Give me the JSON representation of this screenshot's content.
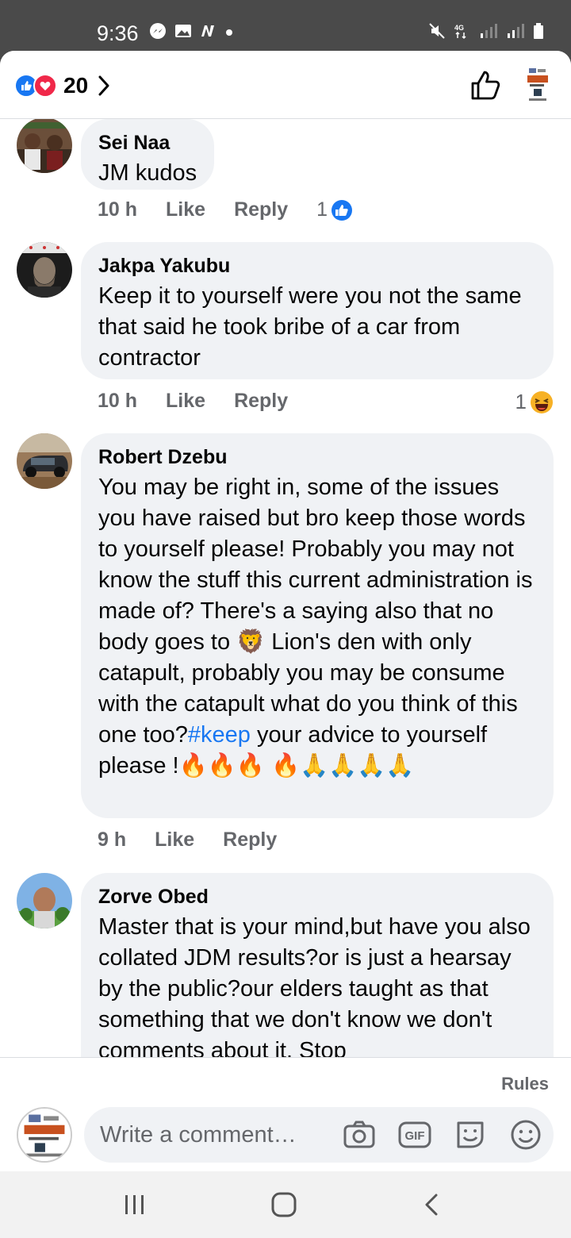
{
  "status": {
    "time": "9:36"
  },
  "header": {
    "reaction_count": "20"
  },
  "comments": [
    {
      "author": "Sei Naa",
      "text": "JM kudos",
      "time": "10 h",
      "like_label": "Like",
      "reply_label": "Reply",
      "reaction_count": "1",
      "reaction_type": "like-icon"
    },
    {
      "author": "Jakpa Yakubu",
      "text": "Keep it to yourself were you not the same that said he took bribe of a car from contractor",
      "time": "10 h",
      "like_label": "Like",
      "reply_label": "Reply",
      "reaction_count": "1",
      "reaction_type": "haha-icon"
    },
    {
      "author": "Robert Dzebu",
      "text_before": "You may be right in, some of the issues you have raised but bro keep those words to yourself please! Probably you may not know the stuff this current administration is made of? There's a saying also that no body goes to 🦁 Lion's den with only catapult, probably you may be consume with the catapult what do you think of this one too?",
      "hashtag": "#keep",
      "text_after": " your advice to yourself please !🔥🔥🔥 🔥🙏🙏🙏🙏",
      "time": "9 h",
      "like_label": "Like",
      "reply_label": "Reply"
    },
    {
      "author": "Zorve Obed",
      "text": "Master that is your mind,but have you also collated JDM results?or is just a hearsay by the public?our elders taught as that something that we don't know we don't comments about it. Stop",
      "time": "",
      "like_label": "",
      "reply_label": ""
    }
  ],
  "footer": {
    "rules_label": "Rules",
    "compose_placeholder": "Write a comment…"
  }
}
